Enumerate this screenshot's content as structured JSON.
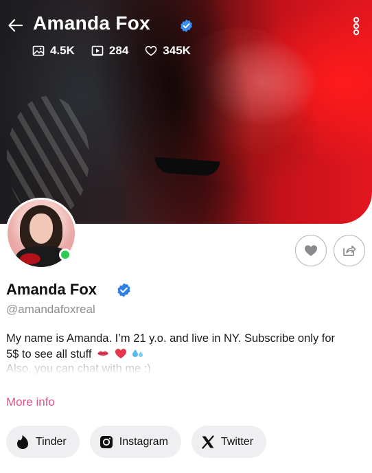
{
  "header": {
    "title": "Amanda Fox",
    "stats": {
      "photos": "4.5K",
      "videos": "284",
      "likes": "345K"
    }
  },
  "profile": {
    "name": "Amanda Fox",
    "handle": "@amandafoxreal",
    "online": true,
    "bio_line1": "My name is Amanda. I’m 21 y.o. and live in NY. Subscribe only for",
    "bio_line2": "5$ to see all stuff",
    "bio_line3": "Also, you can chat with me :)",
    "more_info": "More info"
  },
  "socials": [
    {
      "label": "Tinder",
      "icon": "tinder-flame-icon"
    },
    {
      "label": "Instagram",
      "icon": "instagram-icon"
    },
    {
      "label": "Twitter",
      "icon": "x-logo-icon"
    }
  ],
  "colors": {
    "accent_pink": "#e0558a",
    "verified_blue": "#3b8ff0",
    "online_green": "#2ecc55",
    "chip_bg": "#efeff1"
  }
}
